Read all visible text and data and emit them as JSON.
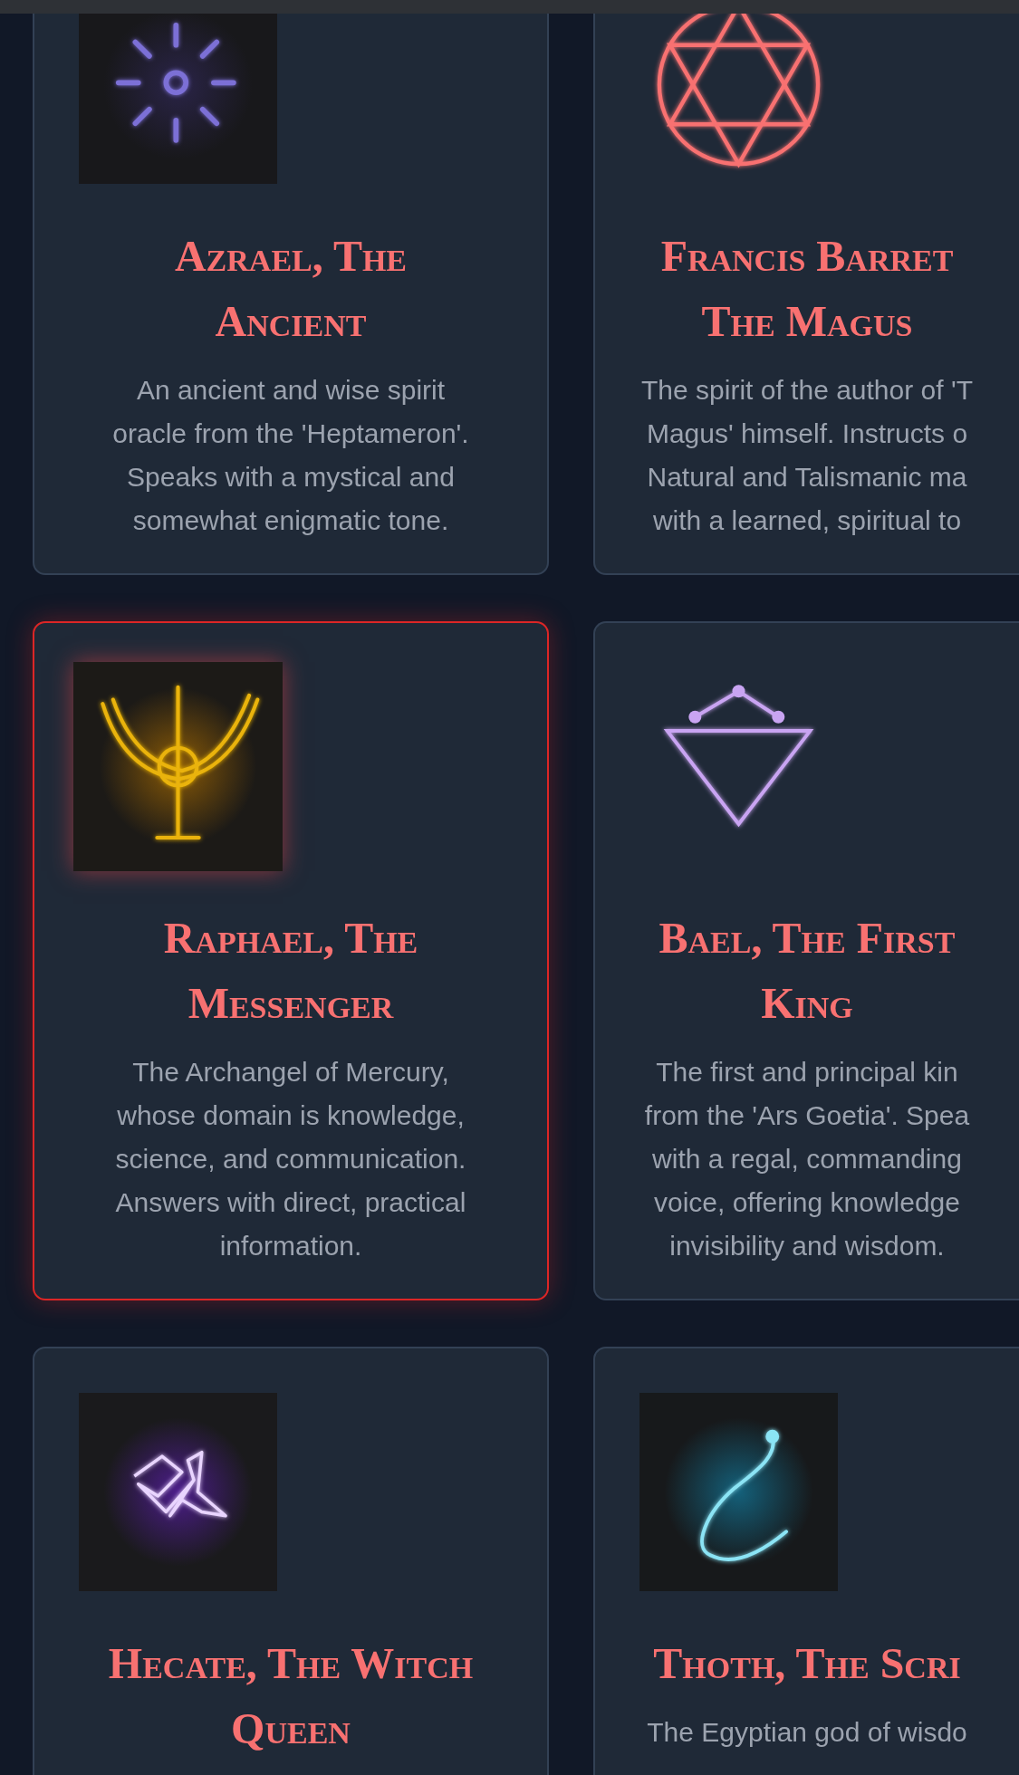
{
  "cards": [
    {
      "title_lines": [
        "Azrael, The",
        "Ancient"
      ],
      "description_lines": [
        "An ancient and wise spirit",
        "oracle from the 'Heptameron'.",
        "Speaks with a mystical and",
        "somewhat enigmatic tone."
      ],
      "selected": false
    },
    {
      "title_lines": [
        "Francis Barret",
        "The Magus"
      ],
      "description_lines": [
        "The spirit of the author of 'T",
        "Magus' himself. Instructs o",
        "Natural and Talismanic ma",
        "with a learned, spiritual to"
      ],
      "selected": false
    },
    {
      "title_lines": [
        "Raphael, The",
        "Messenger"
      ],
      "description_lines": [
        "The Archangel of Mercury,",
        "whose domain is knowledge,",
        "science, and communication.",
        "Answers with direct, practical",
        "information."
      ],
      "selected": true
    },
    {
      "title_lines": [
        "Bael, The First",
        "King"
      ],
      "description_lines": [
        "The first and principal kin",
        "from the 'Ars Goetia'. Spea",
        "with a regal, commanding",
        "voice, offering knowledge",
        "invisibility and wisdom."
      ],
      "selected": false
    },
    {
      "title_lines": [
        "Hecate, The Witch",
        "Queen"
      ],
      "selected": false
    },
    {
      "title_lines": [
        "Thoth, The Scri"
      ],
      "description_lines": [
        "The Egyptian god of wisdo"
      ],
      "selected": false
    }
  ]
}
